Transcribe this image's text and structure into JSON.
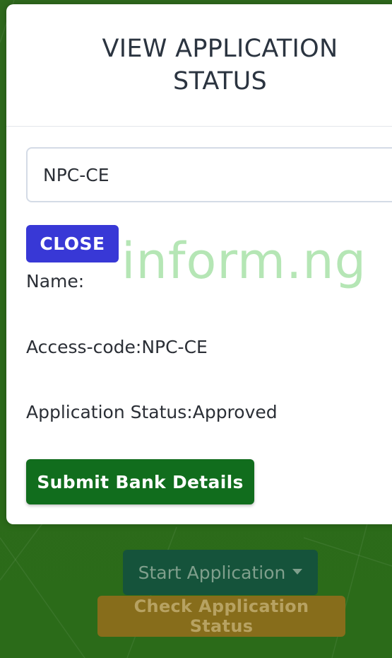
{
  "modal": {
    "title": "VIEW APPLICATION STATUS",
    "access_code_input": {
      "value": "NPC-CE",
      "placeholder": ""
    },
    "close_label": "CLOSE",
    "name_line": "Name:",
    "access_code_line": "Access-code:NPC-CE",
    "status_line": "Application Status:Approved",
    "submit_label": "Submit Bank Details"
  },
  "watermark": "inform.ng",
  "page": {
    "start_application_label": "Start Application",
    "check_status_label": "Check Application Status"
  },
  "colors": {
    "background_green": "#2c6a1a",
    "close_button": "#3838d6",
    "submit_button": "#116d1d",
    "start_button": "#15533b",
    "check_button": "#876d1b",
    "watermark": "#78d278"
  },
  "icons": {
    "dropdown_caret": "caret-down"
  }
}
